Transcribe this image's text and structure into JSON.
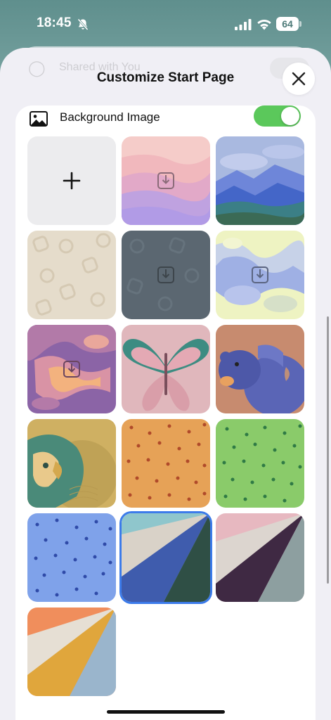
{
  "status_bar": {
    "time": "18:45",
    "battery": "64",
    "icons": [
      "bell-slash-icon",
      "signal-icon",
      "wifi-icon",
      "battery-icon"
    ]
  },
  "sheet": {
    "title": "Customize Start Page",
    "background_row_label": "Shared with You",
    "close_icon": "close-icon"
  },
  "background_image": {
    "label": "Background Image",
    "enabled": true,
    "icon": "photo-icon",
    "toggle_color": "#5bc85b"
  },
  "wallpapers": [
    {
      "name": "add-custom",
      "icon": "plus-icon"
    },
    {
      "name": "pink-dunes",
      "icon": "download-icon"
    },
    {
      "name": "blue-mountains"
    },
    {
      "name": "beige-pattern"
    },
    {
      "name": "gray-pattern",
      "icon": "download-icon"
    },
    {
      "name": "yellow-blue-topography",
      "icon": "download-icon"
    },
    {
      "name": "purple-orange-topography",
      "icon": "download-icon"
    },
    {
      "name": "butterfly"
    },
    {
      "name": "bear"
    },
    {
      "name": "parrot"
    },
    {
      "name": "orange-dots"
    },
    {
      "name": "green-dots"
    },
    {
      "name": "blue-dots"
    },
    {
      "name": "teal-blue-folds",
      "selected": true
    },
    {
      "name": "pink-purple-folds"
    },
    {
      "name": "orange-yellow-folds"
    }
  ],
  "colors": {
    "accent": "#3c7bea",
    "toggle_on": "#5bc85b"
  }
}
